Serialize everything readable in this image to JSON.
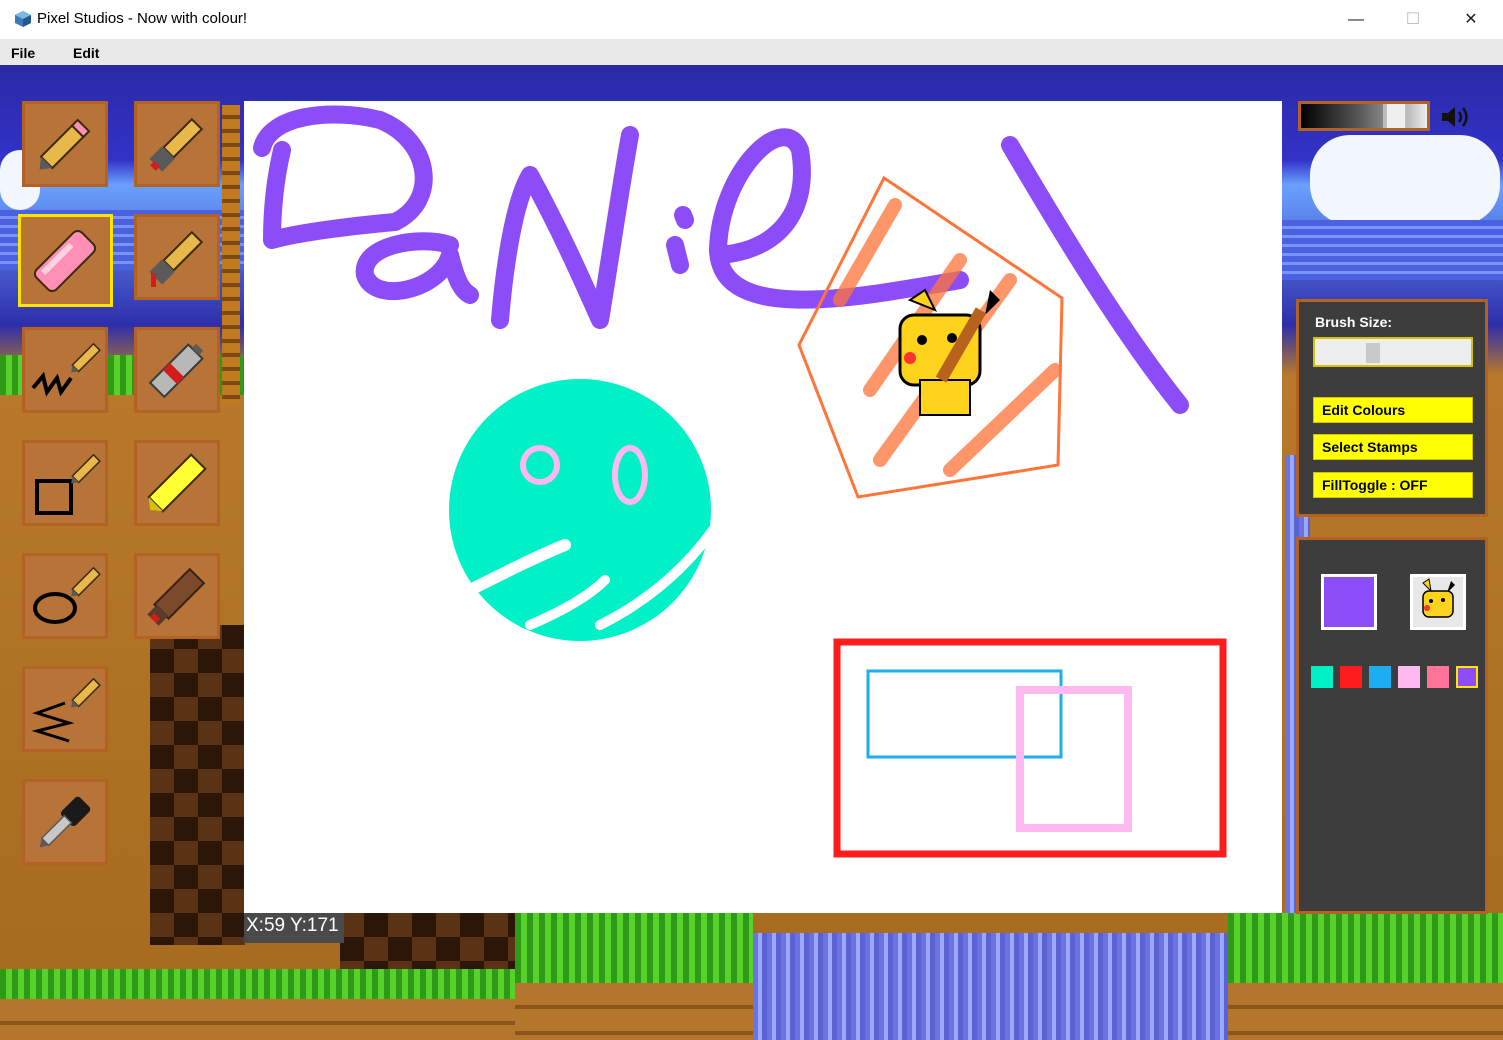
{
  "window": {
    "title": "Pixel Studios - Now with colour!",
    "minimize_label": "—",
    "maximize_label": "☐",
    "close_label": "✕"
  },
  "menu": {
    "file": "File",
    "edit": "Edit"
  },
  "tools": [
    {
      "name": "pencil-tool",
      "icon": "pencil-icon",
      "selected": false
    },
    {
      "name": "paint-brush-tool",
      "icon": "paint-brush-icon",
      "selected": false
    },
    {
      "name": "eraser-tool",
      "icon": "eraser-icon",
      "selected": true
    },
    {
      "name": "drip-brush-tool",
      "icon": "drip-brush-icon",
      "selected": false
    },
    {
      "name": "squiggle-line-tool",
      "icon": "squiggle-pencil-icon",
      "selected": false
    },
    {
      "name": "spray-can-tool",
      "icon": "spray-can-icon",
      "selected": false
    },
    {
      "name": "rectangle-tool",
      "icon": "rectangle-pencil-icon",
      "selected": false
    },
    {
      "name": "highlighter-tool",
      "icon": "highlighter-icon",
      "selected": false
    },
    {
      "name": "ellipse-tool",
      "icon": "ellipse-pencil-icon",
      "selected": false
    },
    {
      "name": "marker-tool",
      "icon": "marker-icon",
      "selected": false
    },
    {
      "name": "zigzag-line-tool",
      "icon": "zigzag-pencil-icon",
      "selected": false
    },
    {
      "name": "eyedropper-tool",
      "icon": "eyedropper-icon",
      "selected": false
    }
  ],
  "status": {
    "coordinates": "X:59 Y:171"
  },
  "right_panel": {
    "brush_size_label": "Brush Size:",
    "brush_size_value": 0.36,
    "shade_slider_value": 0.82,
    "edit_colours": "Edit Colours",
    "select_stamps": "Select Stamps",
    "fill_toggle": "FillToggle : OFF",
    "speaker_icon": "speaker-icon"
  },
  "colors": {
    "current": "#8c4cf8",
    "palette": [
      "#00f0c8",
      "#ff1c1c",
      "#1caef0",
      "#ffb8f0",
      "#ff7498",
      "#8c4cf8"
    ],
    "tool_border": "#b36224",
    "selected_border": "#ffe400"
  },
  "stamp": {
    "current": "pikachu-stamp-icon"
  }
}
